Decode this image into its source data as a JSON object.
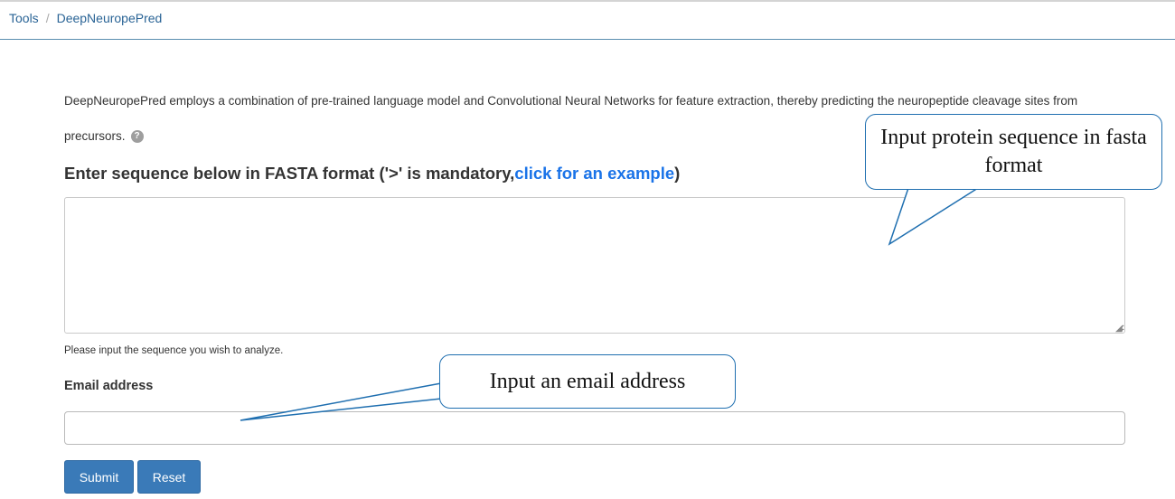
{
  "breadcrumb": {
    "items": [
      "Tools",
      "DeepNeuropePred"
    ],
    "separator": "/"
  },
  "intro": {
    "text": "DeepNeuropePred employs a combination of pre-trained language model and Convolutional Neural Networks for feature extraction, thereby predicting the neuropeptide cleavage sites from precursors.",
    "help_icon": "question-circle-icon"
  },
  "sequence": {
    "heading_prefix": "Enter sequence below in FASTA format ('>' is mandatory,",
    "example_link": "click for an example",
    "heading_suffix": ")",
    "value": "",
    "helper": "Please input the sequence you wish to analyze."
  },
  "email": {
    "label": "Email address",
    "value": ""
  },
  "buttons": {
    "submit": "Submit",
    "reset": "Reset"
  },
  "annotations": {
    "sequence_callout": "Input protein sequence in fasta format",
    "email_callout": "Input an email address"
  },
  "colors": {
    "link": "#1a73e8",
    "button": "#3a7ab8",
    "callout_border": "#1f6fb0"
  }
}
